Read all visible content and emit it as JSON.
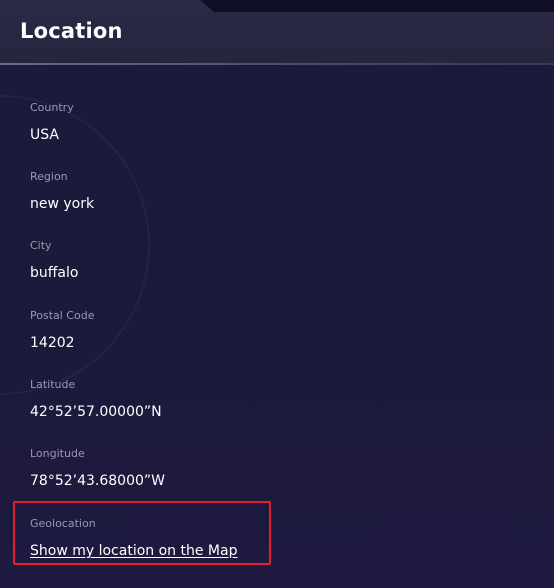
{
  "header": {
    "title": "Location"
  },
  "fields": {
    "country": {
      "label": "Country",
      "value": "USA"
    },
    "region": {
      "label": "Region",
      "value": "new york"
    },
    "city": {
      "label": "City",
      "value": "buffalo"
    },
    "postal_code": {
      "label": "Postal Code",
      "value": "14202"
    },
    "latitude": {
      "label": "Latitude",
      "value": "42°52’57.00000”N"
    },
    "longitude": {
      "label": "Longitude",
      "value": "78°52’43.68000”W"
    },
    "geolocation": {
      "label": "Geolocation",
      "link_text": "Show my location on the Map"
    }
  },
  "colors": {
    "background": "#1b1a3a",
    "header_background": "#29283f",
    "label": "#9a98b0",
    "value": "#ffffff",
    "highlight_border": "#e0202a"
  }
}
